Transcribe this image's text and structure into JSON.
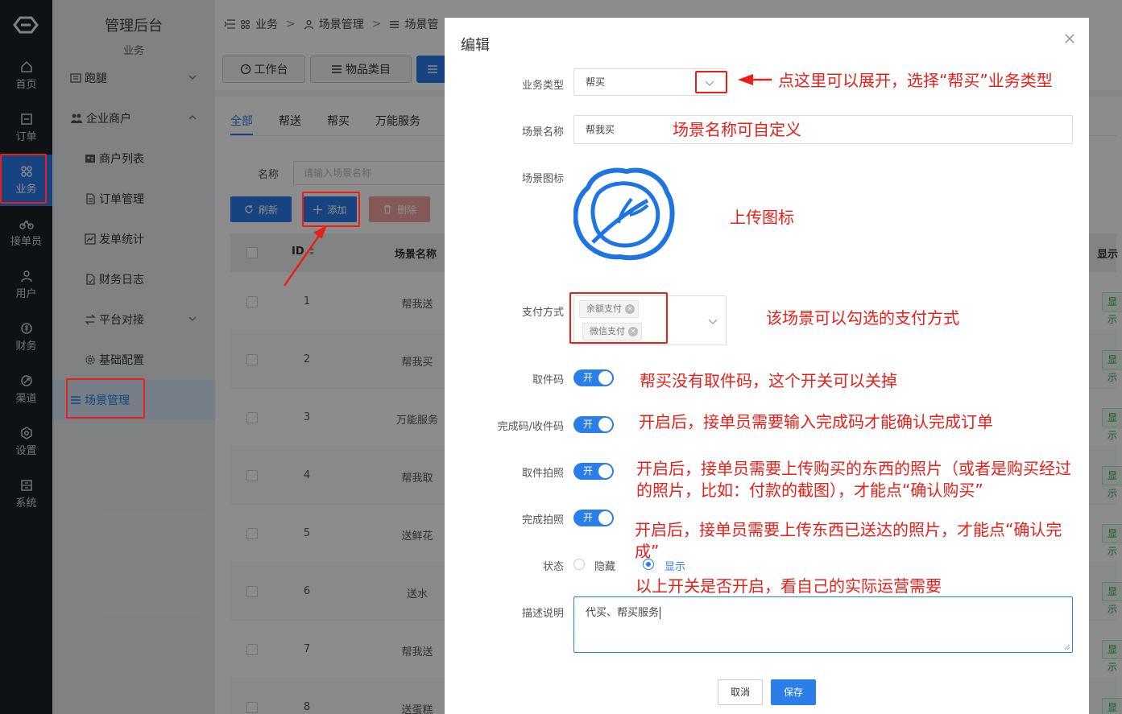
{
  "rail": {
    "items": [
      {
        "label": "首页",
        "icon": "home-icon"
      },
      {
        "label": "订单",
        "icon": "order-icon"
      },
      {
        "label": "业务",
        "icon": "business-icon"
      },
      {
        "label": "接单员",
        "icon": "courier-icon"
      },
      {
        "label": "用户",
        "icon": "user-icon"
      },
      {
        "label": "财务",
        "icon": "finance-icon"
      },
      {
        "label": "渠道",
        "icon": "channel-icon"
      },
      {
        "label": "设置",
        "icon": "settings-icon"
      },
      {
        "label": "系统",
        "icon": "system-icon"
      }
    ],
    "active": "业务"
  },
  "menu": {
    "title": "管理后台",
    "subtitle": "业务",
    "items": [
      {
        "label": "跑腿"
      },
      {
        "label": "企业商户"
      },
      {
        "label": "商户列表"
      },
      {
        "label": "订单管理"
      },
      {
        "label": "发单统计"
      },
      {
        "label": "财务日志"
      },
      {
        "label": "平台对接"
      },
      {
        "label": "基础配置"
      },
      {
        "label": "场景管理"
      }
    ]
  },
  "breadcrumb": [
    "业务",
    "场景管理",
    "场景管"
  ],
  "top_buttons": [
    "工作台",
    "物品类目"
  ],
  "tabs": [
    "全部",
    "帮送",
    "帮买",
    "万能服务"
  ],
  "filter": {
    "label": "名称",
    "placeholder": "请输入场景名称"
  },
  "actions": {
    "refresh": "刷新",
    "add": "添加",
    "delete": "删除"
  },
  "table": {
    "headers": {
      "id": "ID",
      "name": "场景名称",
      "show": "显示"
    },
    "rows": [
      {
        "id": "1",
        "name": "帮我送"
      },
      {
        "id": "2",
        "name": "帮我买"
      },
      {
        "id": "3",
        "name": "万能服务"
      },
      {
        "id": "4",
        "name": "帮我取"
      },
      {
        "id": "5",
        "name": "送鲜花"
      },
      {
        "id": "6",
        "name": "送水"
      },
      {
        "id": "7",
        "name": "帮我送"
      },
      {
        "id": "8",
        "name": "送蛋糕"
      }
    ],
    "show_tag": "显示"
  },
  "modal": {
    "title": "编辑",
    "labels": {
      "type": "业务类型",
      "name": "场景名称",
      "icon": "场景图标",
      "pay": "支付方式",
      "pickup_code": "取件码",
      "finish_code": "完成码/收件码",
      "pickup_photo": "取件拍照",
      "finish_photo": "完成拍照",
      "status": "状态",
      "desc": "描述说明"
    },
    "type_value": "帮买",
    "name_value": "帮我买",
    "pay_chips": [
      "余额支付",
      "微信支付"
    ],
    "toggle_on": "开",
    "status_options": [
      "隐藏",
      "显示"
    ],
    "status_selected": "显示",
    "desc_value": "代买、帮买服务",
    "cancel": "取消",
    "save": "保存"
  },
  "annotations": {
    "type": "点这里可以展开，选择“帮买”业务类型",
    "name": "场景名称可自定义",
    "icon": "上传图标",
    "pay": "该场景可以勾选的支付方式",
    "pickup_code": "帮买没有取件码，这个开关可以关掉",
    "finish_code": "开启后，接单员需要输入完成码才能确认完成订单",
    "pickup_photo_1": "开启后，接单员需要上传购买的东西的照片（或者是购买经过",
    "pickup_photo_2": "的照片，比如：付款的截图），才能点“确认购买”",
    "finish_photo_1": "开启后，接单员需要上传东西已送达的照片，才能点“确认完",
    "finish_photo_2": "成”",
    "summary": "以上开关是否开启，看自己的实际运营需要"
  },
  "colors": {
    "accent": "#2b7de9",
    "annotation": "#e8201a",
    "rail_bg": "#1d2226",
    "success": "#2fa55a",
    "danger": "#f5a3a3"
  }
}
